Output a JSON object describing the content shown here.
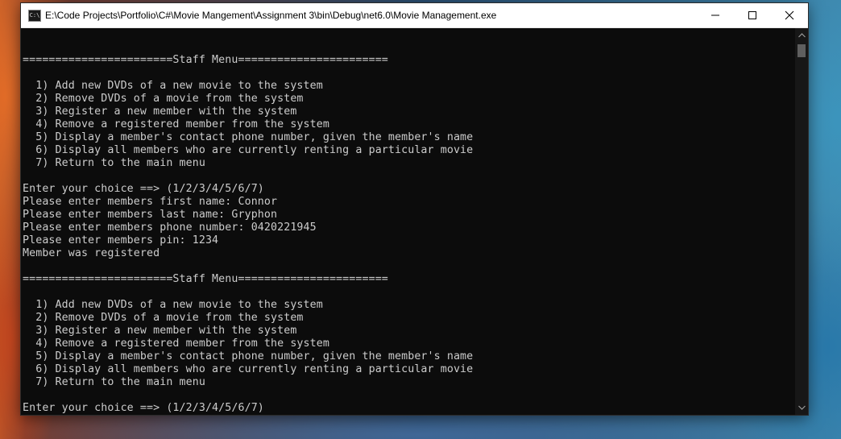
{
  "window": {
    "title": "E:\\Code Projects\\Portfolio\\C#\\Movie Mangement\\Assignment 3\\bin\\Debug\\net6.0\\Movie Management.exe",
    "icon_text": "C:\\",
    "icon": "console-app-icon",
    "controls": {
      "minimize": "minimize-icon",
      "maximize": "maximize-icon",
      "close": "close-icon"
    }
  },
  "console": {
    "lines": [
      "",
      "=======================Staff Menu=======================",
      "",
      "  1) Add new DVDs of a new movie to the system",
      "  2) Remove DVDs of a movie from the system",
      "  3) Register a new member with the system",
      "  4) Remove a registered member from the system",
      "  5) Display a member's contact phone number, given the member's name",
      "  6) Display all members who are currently renting a particular movie",
      "  7) Return to the main menu",
      "",
      "Enter your choice ==> (1/2/3/4/5/6/7)",
      "Please enter members first name: Connor",
      "Please enter members last name: Gryphon",
      "Please enter members phone number: 0420221945",
      "Please enter members pin: 1234",
      "Member was registered",
      "",
      "=======================Staff Menu=======================",
      "",
      "  1) Add new DVDs of a new movie to the system",
      "  2) Remove DVDs of a movie from the system",
      "  3) Register a new member with the system",
      "  4) Remove a registered member from the system",
      "  5) Display a member's contact phone number, given the member's name",
      "  6) Display all members who are currently renting a particular movie",
      "  7) Return to the main menu",
      "",
      "Enter your choice ==> (1/2/3/4/5/6/7)"
    ],
    "colors": {
      "background": "#0c0c0c",
      "foreground": "#cccccc"
    }
  },
  "scrollbar": {
    "up_icon": "scroll-up-arrow-icon",
    "down_icon": "scroll-down-arrow-icon",
    "position": 0.0
  }
}
